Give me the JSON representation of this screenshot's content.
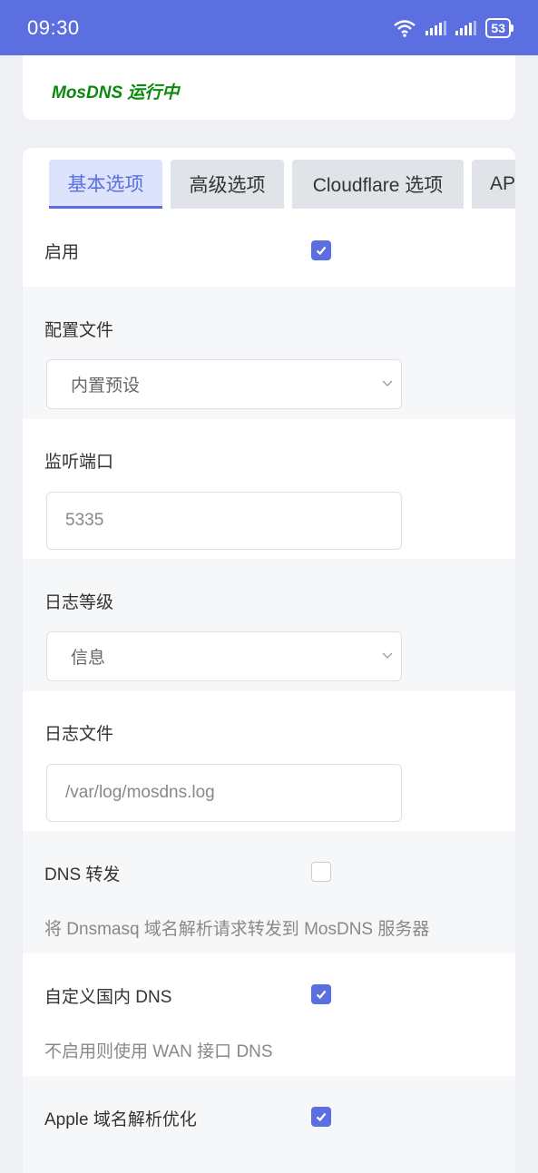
{
  "status_bar": {
    "time": "09:30",
    "battery": "53"
  },
  "status": {
    "text": "MosDNS 运行中",
    "color": "#0a8a0a"
  },
  "tabs": [
    {
      "label": "基本选项",
      "active": true
    },
    {
      "label": "高级选项",
      "active": false
    },
    {
      "label": "Cloudflare 选项",
      "active": false
    },
    {
      "label": "API",
      "active": false
    }
  ],
  "form": {
    "enable": {
      "label": "启用",
      "checked": true
    },
    "config_file": {
      "label": "配置文件",
      "value": "内置预设"
    },
    "listen_port": {
      "label": "监听端口",
      "placeholder": "5335"
    },
    "log_level": {
      "label": "日志等级",
      "value": "信息"
    },
    "log_file": {
      "label": "日志文件",
      "value": "/var/log/mosdns.log"
    },
    "dns_forward": {
      "label": "DNS 转发",
      "checked": false,
      "description": "将 Dnsmasq 域名解析请求转发到 MosDNS 服务器"
    },
    "custom_dns": {
      "label": "自定义国内 DNS",
      "checked": true,
      "description": "不启用则使用 WAN 接口 DNS"
    },
    "apple_opt": {
      "label": "Apple 域名解析优化",
      "checked": true
    }
  },
  "colors": {
    "accent": "#5b6fe0",
    "status_green": "#0a8a0a"
  }
}
